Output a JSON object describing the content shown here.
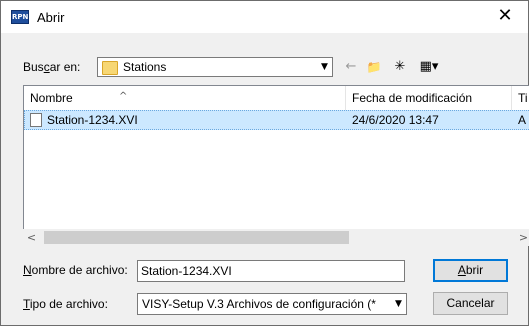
{
  "window": {
    "title": "Abrir",
    "app_icon_text": "RPN",
    "close_glyph": "✕"
  },
  "look_in": {
    "label_prefix": "Bus",
    "label_access": "c",
    "label_suffix": "ar en:",
    "value": "Stations",
    "dropdown_glyph": "▼"
  },
  "toolbar": {
    "back_glyph": "←",
    "up_folder_glyph": "📁",
    "new_folder_glyph": "✳",
    "view_menu_glyph": "▦▾"
  },
  "file_list": {
    "columns": [
      "Nombre",
      "Fecha de modificación",
      "Ti"
    ],
    "sort_glyph": "^",
    "rows": [
      {
        "name": "Station-1234.XVI",
        "modified": "24/6/2020 13:47",
        "type": "A"
      }
    ]
  },
  "scrollbar": {
    "left_glyph": "<",
    "right_glyph": ">"
  },
  "filename": {
    "label_access": "N",
    "label_rest": "ombre de archivo:",
    "value": "Station-1234.XVI"
  },
  "filetype": {
    "label_access": "T",
    "label_rest": "ipo de archivo:",
    "value": "VISY-Setup V.3 Archivos de configuración (*",
    "dropdown_glyph": "▼"
  },
  "buttons": {
    "open_access": "A",
    "open_rest": "brir",
    "cancel": "Cancelar"
  }
}
